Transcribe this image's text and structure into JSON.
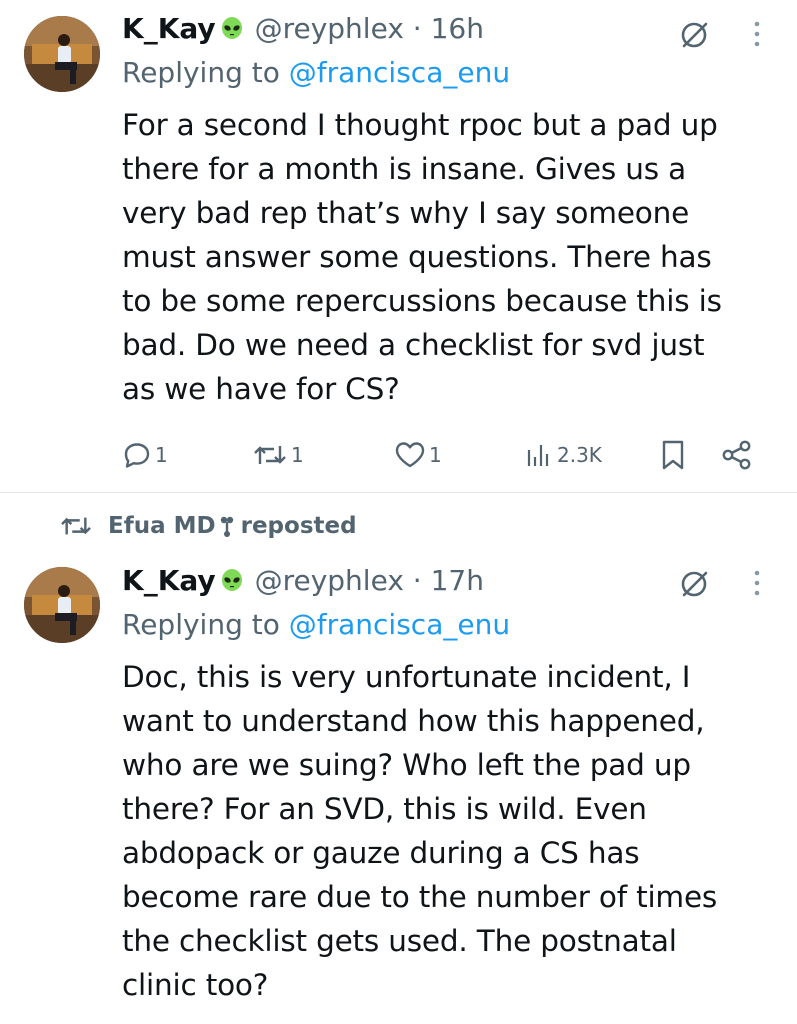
{
  "tweets": [
    {
      "author_name": "K_Kay",
      "author_badge_icon": "alien-emoji-icon",
      "handle": "@reyphlex",
      "separator": "·",
      "time": "16h",
      "replying_prefix": "Replying to",
      "replying_to": "@francisca_enu",
      "body": "For a second I thought rpoc but a pad up\nthere for a month is insane. Gives us a\nvery bad rep that’s why I say someone\nmust answer some questions. There has\nto be some repercussions because this is\nbad. Do we need a checklist for svd just\nas we have for CS?",
      "actions": {
        "reply_count": "1",
        "repost_count": "1",
        "like_count": "1",
        "views_count": "2.3K"
      }
    },
    {
      "reposted_by": "Efua MD",
      "reposted_label": "reposted",
      "author_name": "K_Kay",
      "author_badge_icon": "alien-emoji-icon",
      "handle": "@reyphlex",
      "separator": "·",
      "time": "17h",
      "replying_prefix": "Replying to",
      "replying_to": "@francisca_enu",
      "body": "Doc, this is very unfortunate incident, I\nwant to understand how this happened,\nwho are we suing? Who left the pad up\nthere? For an SVD, this is wild. Even\nabdopack or gauze during a CS has\nbecome rare due to the number of times\nthe checklist gets used. The postnatal\nclinic too?"
    }
  ],
  "colors": {
    "text": "#0f1419",
    "secondary": "#536471",
    "link": "#1d9bf0",
    "alien": "#7ed957",
    "divider": "#e3e6e8"
  }
}
